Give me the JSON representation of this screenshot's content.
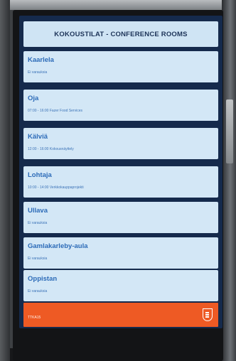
{
  "header": {
    "title": "KOKOUSTILAT - CONFERENCE ROOMS"
  },
  "rooms": [
    {
      "name": "Kaarlela",
      "status": "Ei varauksia"
    },
    {
      "name": "Oja",
      "status": "07:00 - 16:00 Fazer Food Services"
    },
    {
      "name": "Kälviä",
      "status": "12:00 - 16:00 Kokousnäyttely"
    },
    {
      "name": "Lohtaja",
      "status": "10:00 - 14:00 Verkkokauppaprojekti"
    },
    {
      "name": "Ullava",
      "status": "Ei varauksia"
    },
    {
      "name": "Gamlakarleby-aula",
      "status": "Ei varauksia"
    },
    {
      "name": "Oppistan",
      "status": "Ei varauksia"
    }
  ],
  "footer": {
    "text": "TTKA15",
    "logo": "crest-icon"
  },
  "colors": {
    "screen": "#152a4c",
    "card": "#d3e7f6",
    "accent": "#ee5a24",
    "room_name": "#2c6bb8"
  }
}
